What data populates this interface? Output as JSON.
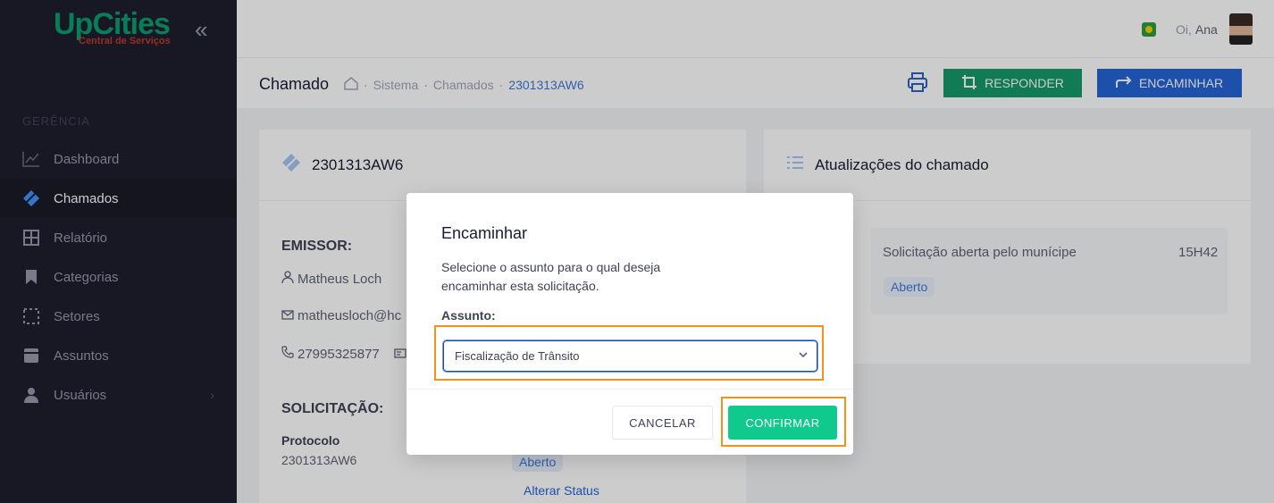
{
  "brand": {
    "name": "UpCities",
    "tagline": "Central de Serviços"
  },
  "sidebar": {
    "section": "GERÊNCIA",
    "items": [
      {
        "label": "Dashboard",
        "icon": "chart-line-icon"
      },
      {
        "label": "Chamados",
        "icon": "ticket-icon",
        "active": true
      },
      {
        "label": "Relatório",
        "icon": "grid-icon"
      },
      {
        "label": "Categorias",
        "icon": "bookmark-icon"
      },
      {
        "label": "Setores",
        "icon": "dotted-square-icon"
      },
      {
        "label": "Assuntos",
        "icon": "archive-icon"
      },
      {
        "label": "Usuários",
        "icon": "user-icon"
      }
    ]
  },
  "header": {
    "greeting": "Oi,",
    "user_name": "Ana"
  },
  "toolbar": {
    "title": "Chamado",
    "breadcrumb": [
      "Sistema",
      "Chamados"
    ],
    "breadcrumb_current": "2301313AW6",
    "respond_label": "RESPONDER",
    "forward_label": "ENCAMINHAR"
  },
  "ticket": {
    "id": "2301313AW6",
    "emitter_title": "EMISSOR:",
    "emitter_name": "Matheus Loch",
    "emitter_email": "matheusloch@hc",
    "emitter_phone": "27995325877",
    "request_title": "SOLICITAÇÃO:",
    "protocol_label": "Protocolo",
    "protocol_value": "2301313AW6",
    "status": "Aberto",
    "change_status": "Alterar Status"
  },
  "updates": {
    "title": "Atualizações do chamado",
    "entry_text": "Solicitação aberta pelo munícipe",
    "entry_time": "15H42",
    "entry_status": "Aberto"
  },
  "modal": {
    "title": "Encaminhar",
    "description": "Selecione o assunto para o qual deseja encaminhar esta solicitação.",
    "field_label": "Assunto:",
    "selected": "Fiscalização de Trânsito",
    "cancel_label": "CANCELAR",
    "confirm_label": "CONFIRMAR"
  }
}
